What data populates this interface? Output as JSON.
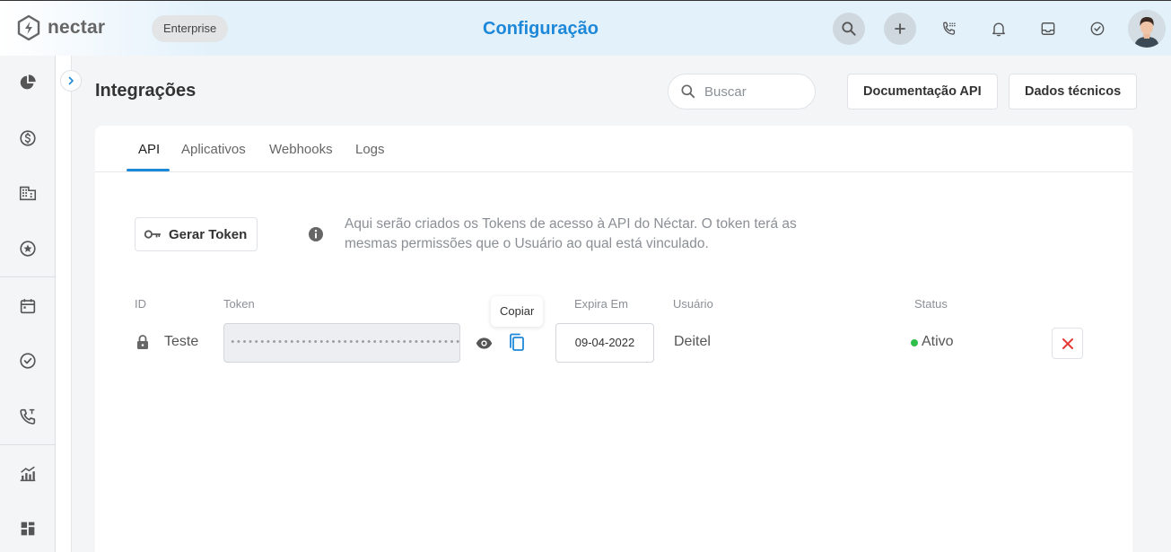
{
  "app": {
    "logo_text": "nectar",
    "plan_badge": "Enterprise",
    "page_title": "Configuração",
    "accent_color": "#1e88d8"
  },
  "topbar": {
    "actions": [
      "search-icon",
      "plus-icon",
      "phone-dialpad-icon",
      "bell-icon",
      "inbox-icon",
      "check-circle-icon",
      "user-avatar"
    ]
  },
  "sidebar": {
    "items": [
      "pie-chart-icon",
      "dollar-icon",
      "building-icon",
      "star-icon",
      "calendar-icon",
      "check-circle-icon",
      "phone-icon",
      "bar-chart-icon",
      "dashboard-icon"
    ]
  },
  "header": {
    "title": "Integrações",
    "search_placeholder": "Buscar",
    "doc_button": "Documentação API",
    "tech_button": "Dados técnicos"
  },
  "tabs": [
    {
      "label": "API",
      "active": true
    },
    {
      "label": "Aplicativos",
      "active": false
    },
    {
      "label": "Webhooks",
      "active": false
    },
    {
      "label": "Logs",
      "active": false
    }
  ],
  "api": {
    "generate_button": "Gerar Token",
    "info_text": "Aqui serão criados os Tokens de acesso à API do Néctar. O token terá as mesmas permissões que o Usuário ao qual está vinculado.",
    "columns": {
      "id": "ID",
      "token": "Token",
      "expires": "Expira Em",
      "user": "Usuário",
      "status": "Status"
    },
    "tooltip": "Copiar",
    "row": {
      "id": "Teste",
      "token": "••••••••••••••••••••••••••••••••••••••••••••••••",
      "expires": "09-04-2022",
      "user": "Deitel",
      "status": "Ativo",
      "status_color": "#2fbf4a"
    }
  }
}
